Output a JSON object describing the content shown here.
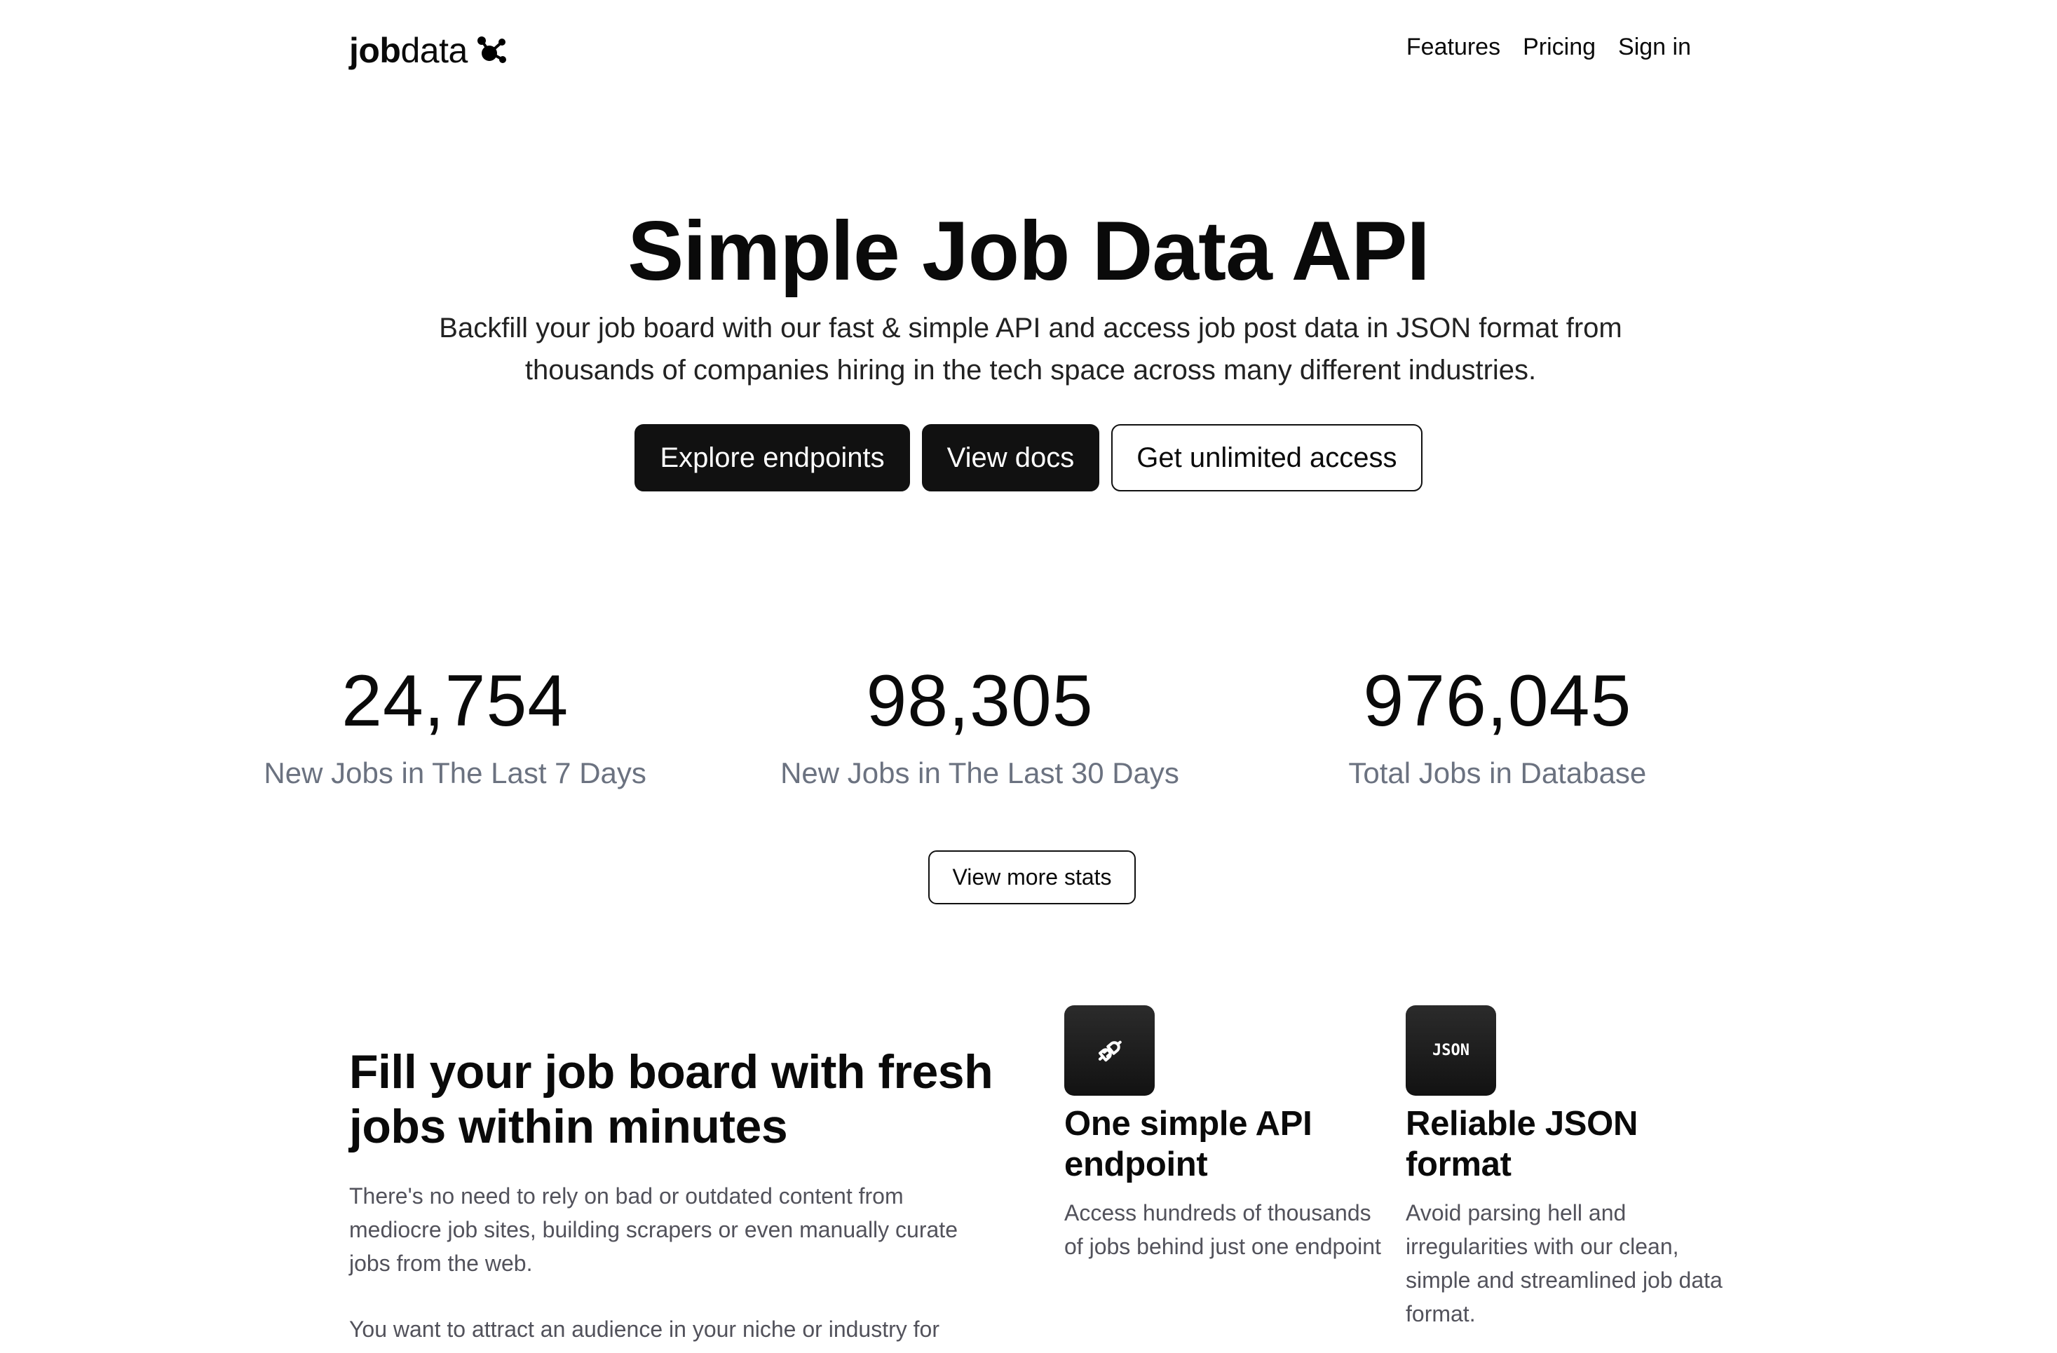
{
  "header": {
    "logo": {
      "bold": "job",
      "light": "data",
      "icon": "network-nodes-icon"
    },
    "nav": [
      {
        "label": "Features"
      },
      {
        "label": "Pricing"
      },
      {
        "label": "Sign in"
      }
    ]
  },
  "hero": {
    "title": "Simple Job Data API",
    "subtitle": "Backfill your job board with our fast & simple API and access job post data in JSON format from thousands of companies hiring in the tech space across many different industries.",
    "buttons": [
      {
        "label": "Explore endpoints",
        "style": "dark"
      },
      {
        "label": "View docs",
        "style": "dark"
      },
      {
        "label": "Get unlimited access",
        "style": "outline"
      }
    ]
  },
  "stats": {
    "items": [
      {
        "value": "24,754",
        "label": "New Jobs in The Last 7 Days"
      },
      {
        "value": "98,305",
        "label": "New Jobs in The Last 30 Days"
      },
      {
        "value": "976,045",
        "label": "Total Jobs in Database"
      }
    ],
    "more_button": "View more stats"
  },
  "features": {
    "title": "Fill your job board with fresh jobs within minutes",
    "paragraphs": [
      "There's no need to rely on bad or outdated content from mediocre job sites, building scrapers or even manually curate jobs from the web.",
      "You want to attract an audience in your niche or industry for"
    ],
    "cards": [
      {
        "icon": "plug-icon",
        "title": "One simple API endpoint",
        "description": "Access hundreds of thousands of jobs behind just one endpoint"
      },
      {
        "icon": "json-icon",
        "icon_text": "JSON",
        "title": "Reliable JSON format",
        "description": "Avoid parsing hell and irregularities with our clean, simple and streamlined job data format."
      }
    ]
  },
  "colors": {
    "primary_button": "#111111",
    "text": "#0a0a0a",
    "muted": "#6b7280",
    "body_text": "#52525b"
  }
}
